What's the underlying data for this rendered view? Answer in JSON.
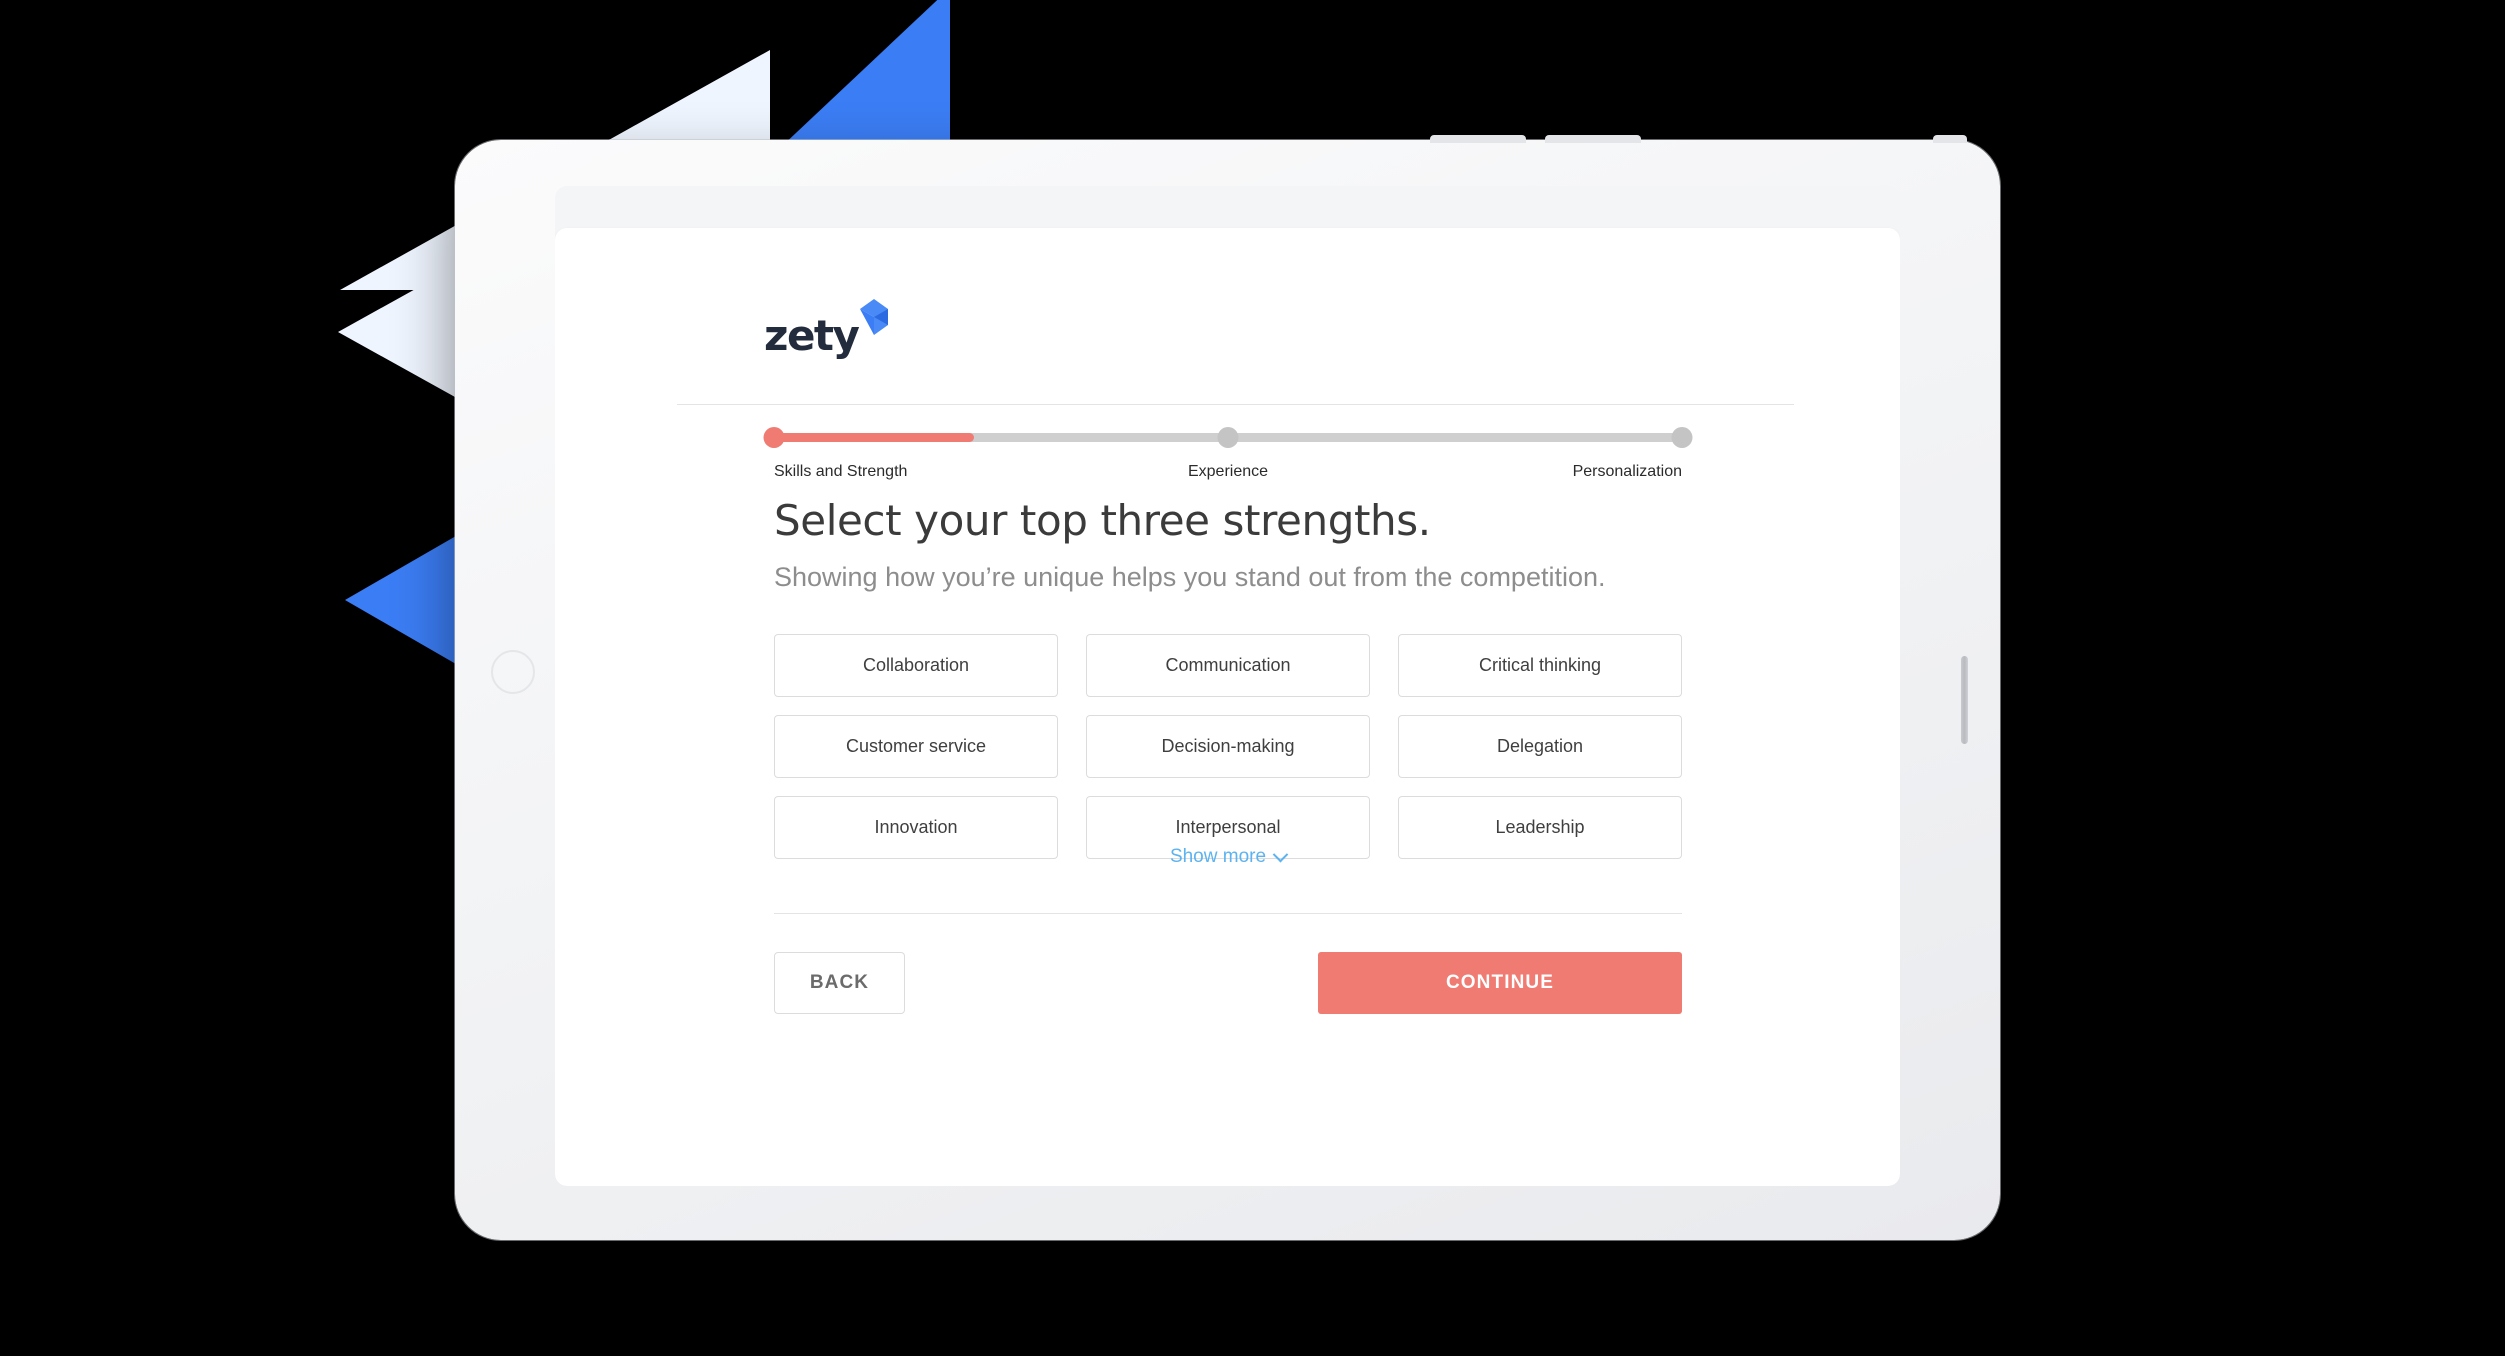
{
  "brand": {
    "logo_text": "zety",
    "logo_mark_name": "zety-ribbon-mark",
    "logo_text_color": "#232c3d",
    "logo_mark_color": "#3b7df4",
    "accent_color": "#ef7b72",
    "link_color": "#5cb3ef"
  },
  "stepper": {
    "active_index": 0,
    "fill_percent": 22,
    "steps": [
      {
        "label": "Skills and Strength",
        "state": "active",
        "position_percent": 0
      },
      {
        "label": "Experience",
        "state": "inactive",
        "position_percent": 50
      },
      {
        "label": "Personalization",
        "state": "inactive",
        "position_percent": 100
      }
    ]
  },
  "main": {
    "title": "Select your top three strengths.",
    "subtitle": "Showing how you’re unique helps you stand out from the competition.",
    "options": [
      "Collaboration",
      "Communication",
      "Critical thinking",
      "Customer service",
      "Decision-making",
      "Delegation",
      "Innovation",
      "Interpersonal",
      "Leadership"
    ],
    "show_more_label": "Show more",
    "show_more_icon": "chevron-down-icon"
  },
  "footer": {
    "back_label": "BACK",
    "continue_label": "CONTINUE"
  },
  "device": {
    "type": "tablet",
    "home_button": "home-button",
    "side_slot": "camera-slot"
  }
}
